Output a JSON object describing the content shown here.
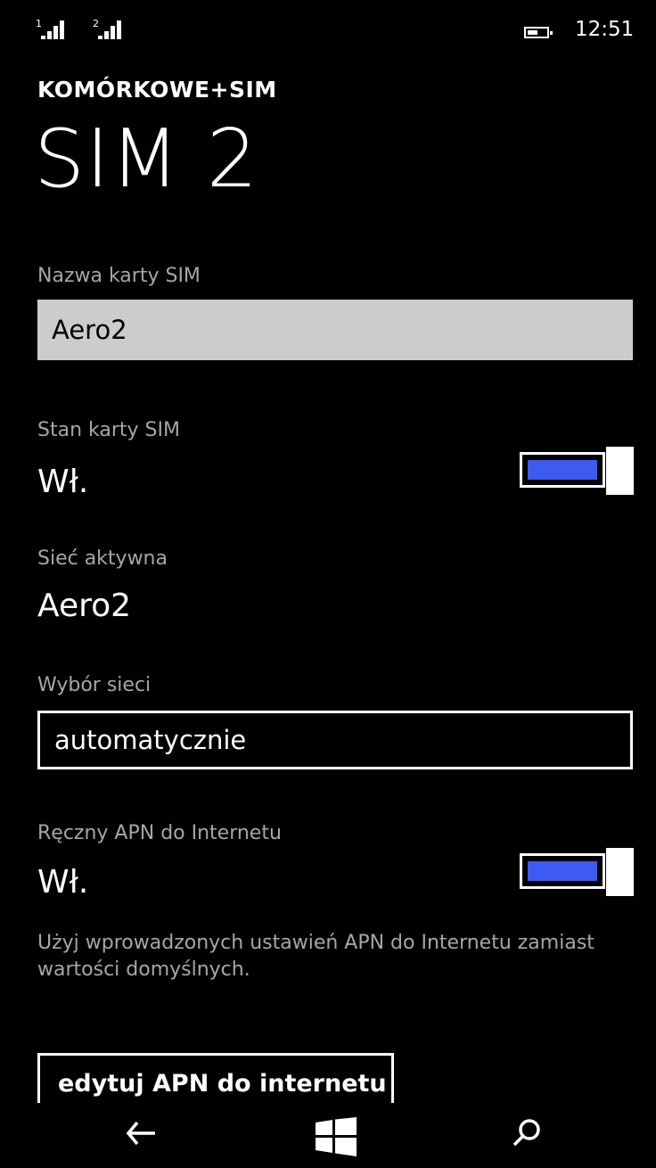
{
  "status_bar": {
    "sim1_index": "1",
    "sim2_index": "2",
    "time": "12:51"
  },
  "header": {
    "section": "KOMÓRKOWE+SIM",
    "title": "SIM 2"
  },
  "sim_name": {
    "label": "Nazwa karty SIM",
    "value": "Aero2"
  },
  "sim_state": {
    "label": "Stan karty SIM",
    "value": "Wł.",
    "on": true
  },
  "active_network": {
    "label": "Sieć aktywna",
    "value": "Aero2"
  },
  "network_selection": {
    "label": "Wybór sieci",
    "value": "automatycznie"
  },
  "manual_apn": {
    "label": "Ręczny APN do Internetu",
    "value": "Wł.",
    "on": true,
    "description": "Użyj wprowadzonych ustawień APN do Internetu zamiast wartości domyślnych."
  },
  "edit_apn_button": {
    "label": "edytuj APN do internetu"
  },
  "colors": {
    "accent": "#3d5af1",
    "background": "#000000",
    "textbox_bg": "#cccccc",
    "label_gray": "#a6a6a6"
  },
  "icons": {
    "back": "back-arrow-icon",
    "start": "windows-logo-icon",
    "search": "search-icon"
  }
}
